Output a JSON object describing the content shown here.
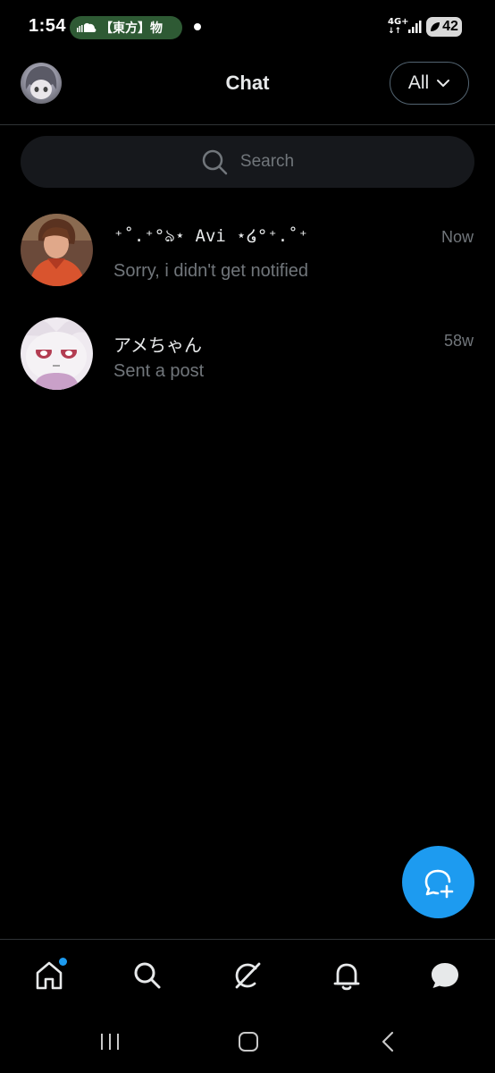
{
  "status_bar": {
    "time": "1:54",
    "media_title": "【東方】物",
    "network": "4G+",
    "network_arrows": "↓↑",
    "battery": "42"
  },
  "header": {
    "title": "Chat",
    "filter_label": "All"
  },
  "search": {
    "placeholder": "Search"
  },
  "conversations": [
    {
      "name": "⁺˚.⁺°ঌ⋆ Avi ⋆໒°⁺.˚⁺",
      "preview": "Sorry, i didn't get notified",
      "time": "Now"
    },
    {
      "name": "アメちゃん",
      "preview": "Sent a post",
      "time": "58w"
    }
  ],
  "bottom_nav": {
    "items": [
      "home-icon",
      "search-icon",
      "grok-icon",
      "notifications-icon",
      "messages-icon"
    ],
    "home_has_badge": true
  },
  "colors": {
    "background": "#000000",
    "accent": "#1d9bf0",
    "text_primary": "#e7e9ea",
    "text_secondary": "#71767b",
    "divider": "#2f3336",
    "search_bg": "#16181c",
    "media_pill": "#2e5a34"
  }
}
